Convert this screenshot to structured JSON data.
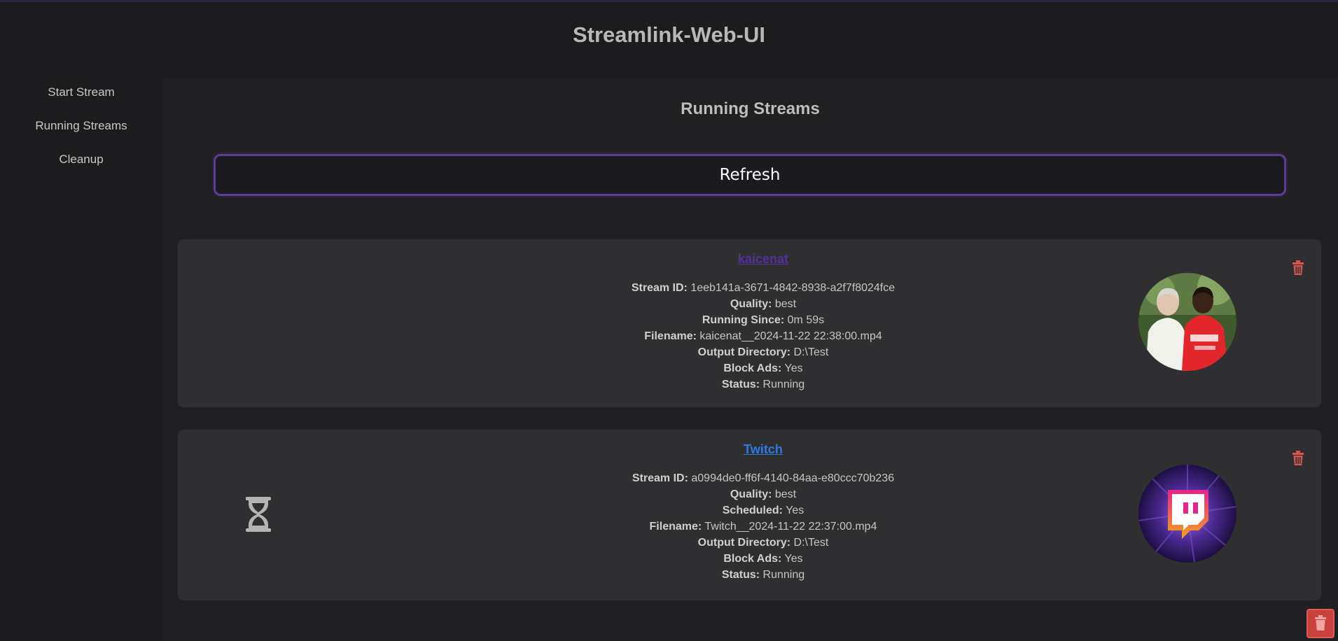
{
  "app": {
    "title": "Streamlink-Web-UI"
  },
  "sidebar": {
    "items": [
      {
        "label": "Start Stream"
      },
      {
        "label": "Running Streams"
      },
      {
        "label": "Cleanup"
      }
    ]
  },
  "main": {
    "title": "Running Streams",
    "refresh_label": "Refresh"
  },
  "labels": {
    "stream_id": "Stream ID:",
    "quality": "Quality:",
    "running_since": "Running Since:",
    "scheduled": "Scheduled:",
    "filename": "Filename:",
    "output_directory": "Output Directory:",
    "block_ads": "Block Ads:",
    "status": "Status:"
  },
  "streams": [
    {
      "name": "kaicenat",
      "stream_id": "1eeb141a-3671-4842-8938-a2f7f8024fce",
      "quality": "best",
      "running_since": "0m 59s",
      "filename": "kaicenat__2024-11-22 22:38:00.mp4",
      "output_directory": "D:\\Test",
      "block_ads": "Yes",
      "status": "Running",
      "avatar_icon": "channel-avatar-photo"
    },
    {
      "name": "Twitch",
      "stream_id": "a0994de0-ff6f-4140-84aa-e80ccc70b236",
      "quality": "best",
      "scheduled": "Yes",
      "filename": "Twitch__2024-11-22 22:37:00.mp4",
      "output_directory": "D:\\Test",
      "block_ads": "Yes",
      "status": "Running",
      "scheduled_icon": "hourglass-icon",
      "avatar_icon": "twitch-logo-avatar"
    }
  ],
  "colors": {
    "accent": "#5c3b94",
    "danger": "#d9534f",
    "link_visited": "#55309b",
    "link": "#2d79e0"
  }
}
